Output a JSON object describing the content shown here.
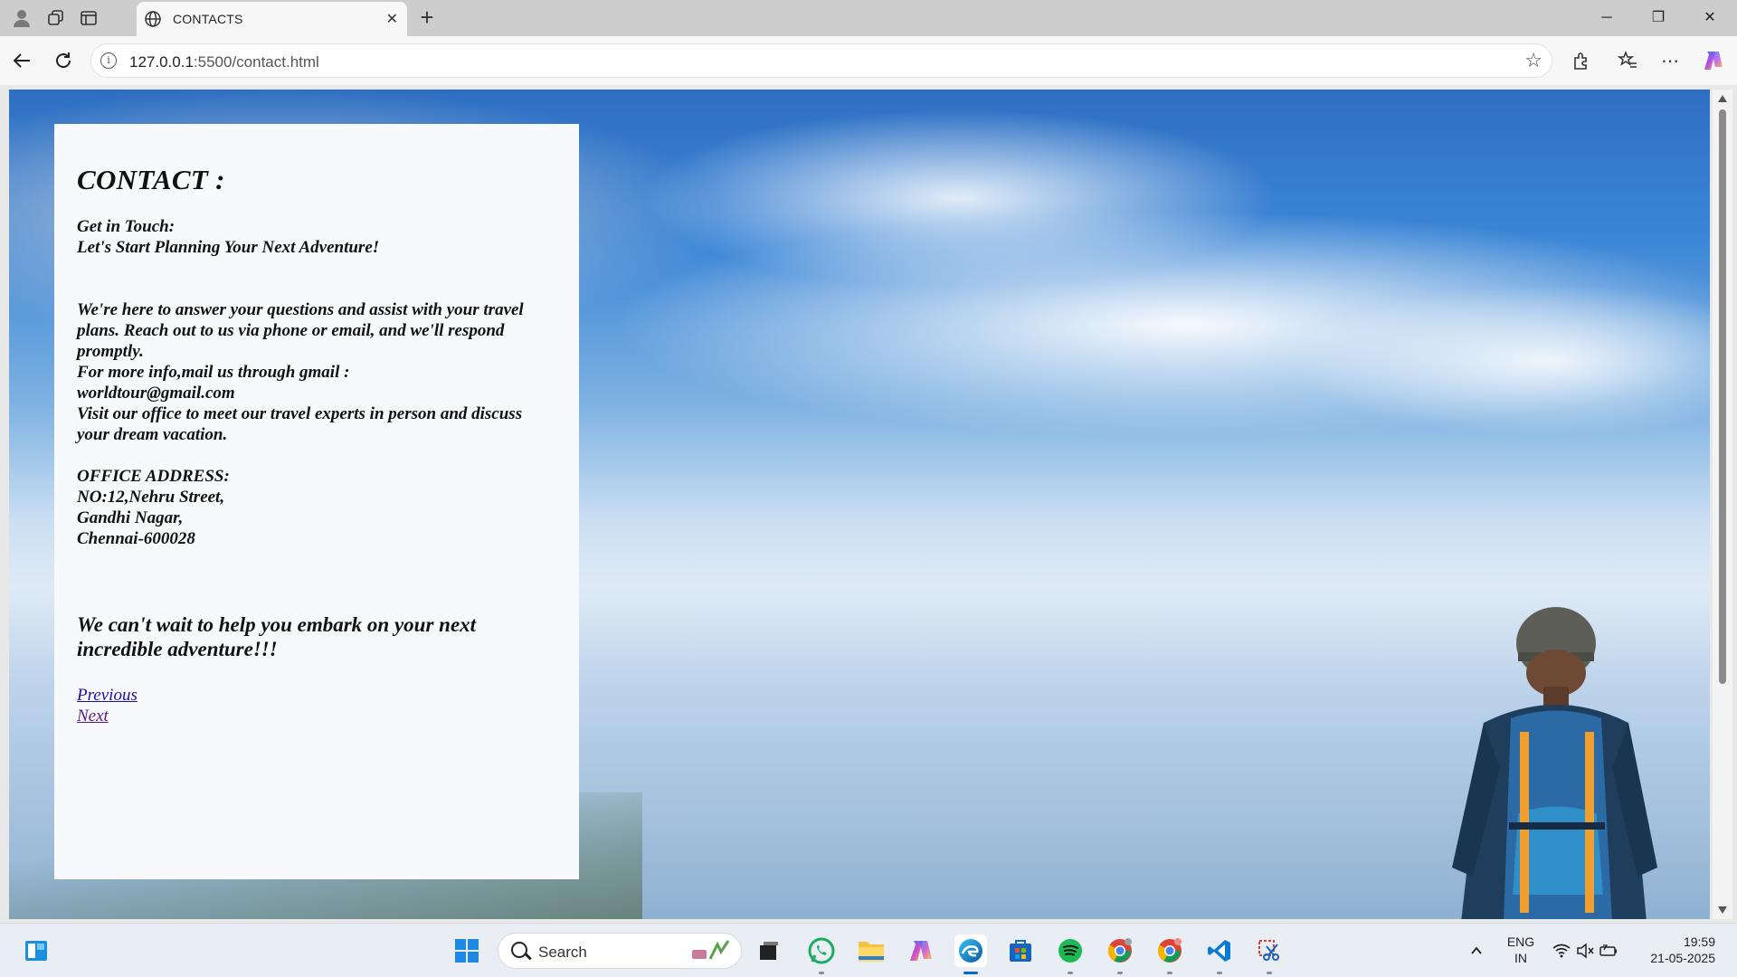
{
  "browser": {
    "tab_title": "CONTACTS",
    "url_host": "127.0.0.1",
    "url_rest": ":5500/contact.html"
  },
  "page": {
    "heading": "CONTACT :",
    "intro_line1": "Get in Touch:",
    "intro_line2": "Let's Start Planning Your Next Adventure!",
    "body_para": "We're here to answer your questions and assist with your travel plans. Reach out to us via phone or email, and we'll respond promptly.",
    "mail_line": "For more info,mail us through gmail :",
    "email": "worldtour@gmail.com",
    "visit_line": "Visit our office to meet our travel experts in person and discuss your dream vacation.",
    "address_label": "OFFICE ADDRESS:",
    "address_line1": "NO:12,Nehru Street,",
    "address_line2": "Gandhi Nagar,",
    "address_line3": "Chennai-600028",
    "closing": "We can't wait to help you embark on your next incredible adventure!!!",
    "link_previous": "Previous",
    "link_next": "Next"
  },
  "taskbar": {
    "search_label": "Search",
    "lang_line1": "ENG",
    "lang_line2": "IN",
    "time": "19:59",
    "date": "21-05-2025"
  },
  "colors": {
    "link": "#1a0dab",
    "link_visited": "#551a8b",
    "panel_bg": "#f8f9fd"
  }
}
